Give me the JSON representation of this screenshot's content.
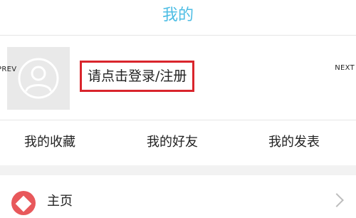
{
  "header": {
    "title": "我的"
  },
  "profile": {
    "prev_label": "PREV",
    "next_label": "NEXT",
    "login_text": "请点击登录/注册",
    "avatar_icon": "user-silhouette-icon"
  },
  "tabs": [
    {
      "label": "我的收藏"
    },
    {
      "label": "我的好友"
    },
    {
      "label": "我的发表"
    }
  ],
  "list": [
    {
      "label": "主页",
      "icon": "red-circle-icon"
    }
  ],
  "colors": {
    "title": "#4dbde4",
    "highlight_border": "#d9252c",
    "divider": "#e6e6e6",
    "section_gap": "#f2f2f2",
    "avatar_bg": "#e9e9e9",
    "row_icon": "#e8585b"
  }
}
